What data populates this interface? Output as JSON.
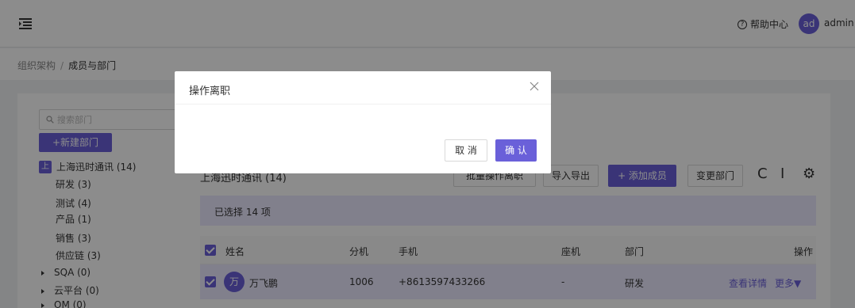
{
  "topbar": {
    "help_label": "帮助中心",
    "avatar_text": "ad",
    "username": "admin"
  },
  "breadcrumb": {
    "parent": "组织架构",
    "separator": "/",
    "current": "成员与部门"
  },
  "sidebar": {
    "search_placeholder": "搜索部门",
    "new_dept_label": "+新建部门",
    "root": {
      "badge": "上",
      "label": "上海迅时通讯 (14)"
    },
    "children": [
      {
        "label": "研发 (3)"
      },
      {
        "label": "测试 (4)"
      },
      {
        "label": "产品 (1)"
      },
      {
        "label": "销售 (3)"
      },
      {
        "label": "供应链 (3)"
      }
    ],
    "collapsed": [
      {
        "label": "SQA (0)"
      },
      {
        "label": "云平台 (0)"
      },
      {
        "label": "OM (0)"
      }
    ]
  },
  "main": {
    "title": "上海迅时通讯 (14)",
    "batch_leave_label": "批量操作离职",
    "import_export_label": "导入导出",
    "add_member_label": "+ 添加成员",
    "change_dept_label": "变更部门",
    "selected_text": "已选择 14 项",
    "columns": [
      "姓名",
      "分机",
      "手机",
      "座机",
      "部门",
      "操作"
    ],
    "rows": [
      {
        "avatar": "万",
        "name": "万飞鹏",
        "extension": "1006",
        "mobile": "+8613597433266",
        "landline": "-",
        "department": "研发",
        "detail_link": "查看详情",
        "more_link": "更多▼"
      }
    ]
  },
  "modal": {
    "title": "操作离职",
    "cancel_label": "取 消",
    "confirm_label": "确 认"
  },
  "colors": {
    "accent": "#6a60d9",
    "selected_bg": "#eceaff",
    "mask": "rgba(0,0,0,0.45)"
  }
}
